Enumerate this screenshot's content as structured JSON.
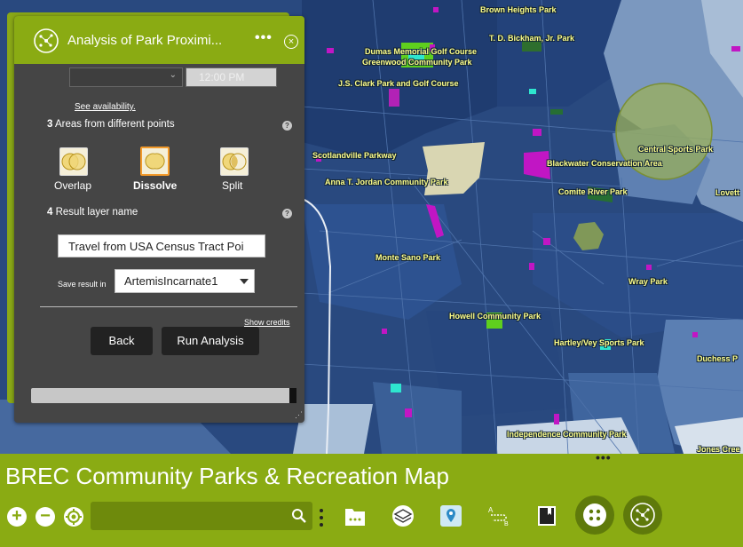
{
  "map": {
    "labels": [
      {
        "text": "Brown Heights Park"
      },
      {
        "text": "T. D. Bickham, Jr. Park"
      },
      {
        "text": "Dumas Memorial Golf Course"
      },
      {
        "text": "Greenwood Community Park"
      },
      {
        "text": "J.S. Clark Park and Golf Course"
      },
      {
        "text": "Scotlandville Parkway"
      },
      {
        "text": "Anna T. Jordan Community Park"
      },
      {
        "text": "Blackwater Conservation Area"
      },
      {
        "text": "Central Sports Park"
      },
      {
        "text": "Comite River Park"
      },
      {
        "text": "Lovett"
      },
      {
        "text": "Monte Sano Park"
      },
      {
        "text": "Wray Park"
      },
      {
        "text": "Howell Community Park"
      },
      {
        "text": "Hartley/Vey Sports Park"
      },
      {
        "text": "Duchess P"
      },
      {
        "text": "Independence Community Park"
      },
      {
        "text": "Jones Cree"
      }
    ]
  },
  "panel": {
    "title": "Analysis of Park Proximi...",
    "availability_link": "See availability.",
    "time_value": "12:00 PM",
    "section3": {
      "num": "3",
      "label": "Areas from different points"
    },
    "options": [
      {
        "label": "Overlap",
        "selected": false
      },
      {
        "label": "Dissolve",
        "selected": true
      },
      {
        "label": "Split",
        "selected": false
      }
    ],
    "section4": {
      "num": "4",
      "label": "Result layer name"
    },
    "result_name": "Travel from USA Census Tract Poi",
    "save_label": "Save result in",
    "save_value": "ArtemisIncarnate1",
    "credits_link": "Show credits",
    "back_label": "Back",
    "run_label": "Run Analysis",
    "colors": {
      "header": "#8aab13",
      "body": "#454545",
      "selected_border": "#f39a2a"
    }
  },
  "app": {
    "title": "BREC Community Parks & Recreation Map",
    "search_placeholder": "",
    "zoom_in": "+",
    "zoom_out": "−",
    "tools": [
      "layer-list-icon",
      "basemap-gallery-icon",
      "directions-icon",
      "measurement-icon",
      "bookmark-icon",
      "analysis-icon",
      "analysis-active-icon"
    ]
  }
}
